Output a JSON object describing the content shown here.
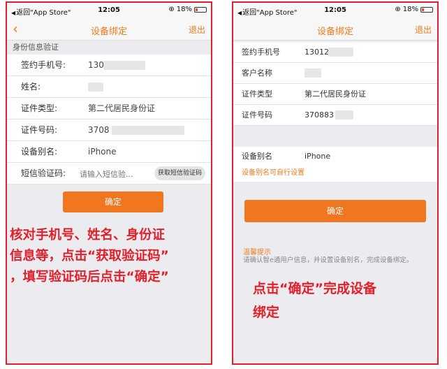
{
  "status_bar": {
    "back_to_app": "返回\"App Store\"",
    "time": "12:05",
    "battery": "18%",
    "battery_level": 0.18
  },
  "left": {
    "nav": {
      "title": "设备绑定",
      "exit": "退出"
    },
    "section_header": "身份信息验证",
    "rows": [
      {
        "label": "签约手机号:",
        "value": "130"
      },
      {
        "label": "姓名:",
        "value": ""
      },
      {
        "label": "证件类型:",
        "value": "第二代居民身份证"
      },
      {
        "label": "证件号码:",
        "value": "3708"
      },
      {
        "label": "设备别名:",
        "value": "iPhone"
      }
    ],
    "sms": {
      "label": "短信验证码:",
      "placeholder": "请输入短信验...",
      "button": "获取短信验证码"
    },
    "confirm_button": "确定",
    "instructions": [
      "核对手机号、姓名、身份证",
      "信息等，点击“获取验证码”",
      "，填写验证码后点击“确定”"
    ]
  },
  "right": {
    "nav": {
      "title": "设备绑定",
      "exit": "退出"
    },
    "rows": [
      {
        "label": "签约手机号",
        "value": "13012"
      },
      {
        "label": "客户名称",
        "value": ""
      },
      {
        "label": "证件类型",
        "value": "第二代居民身份证"
      },
      {
        "label": "证件号码",
        "value": "370883"
      }
    ],
    "alias": {
      "label": "设备别名",
      "value": "iPhone",
      "hint": "设备别名可自行设置"
    },
    "confirm_button": "确定",
    "tip_title": "温馨提示",
    "tip_text": "请确认智e通用户信息，并设置设备别名，完成设备绑定。",
    "instructions": [
      "点击“确定”完成设备",
      "绑定"
    ]
  },
  "colors": {
    "accent": "#f07b1d",
    "frame": "#e0202a",
    "button": "#f0761f"
  }
}
